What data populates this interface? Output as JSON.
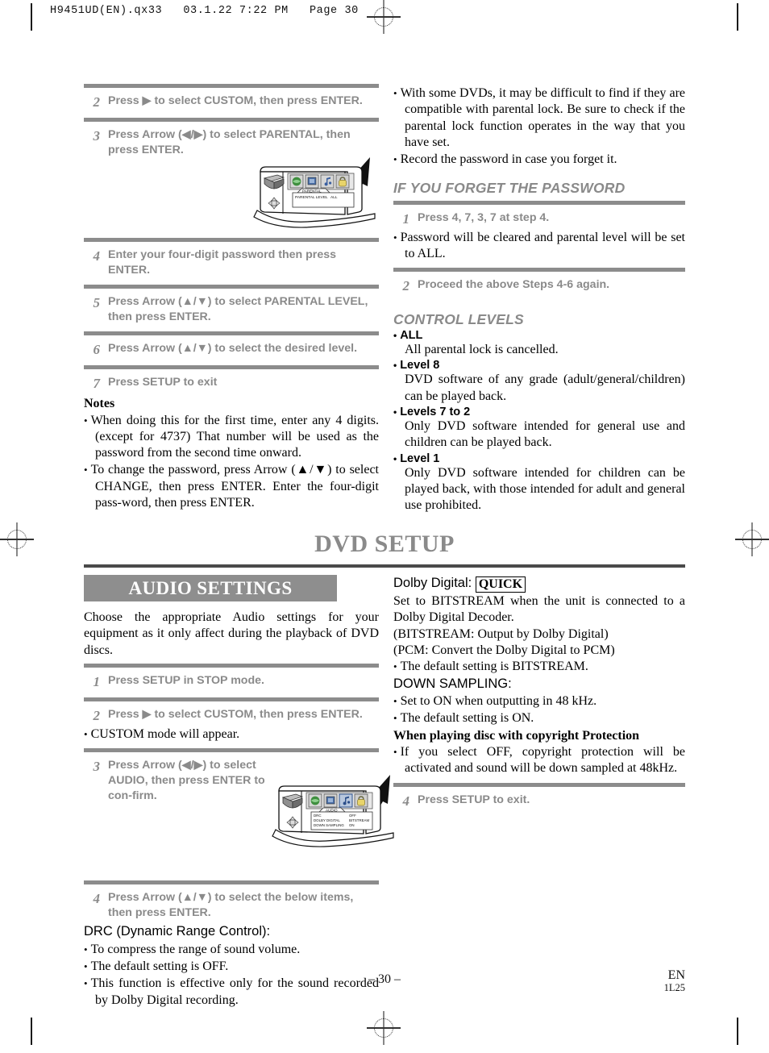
{
  "file_header": "H9451UD(EN).qx33   03.1.22 7:22 PM   Page 30",
  "left_column": {
    "parental_steps": [
      {
        "num": "2",
        "text": "Press ▶ to select CUSTOM, then press ENTER."
      },
      {
        "num": "3",
        "text": "Press Arrow (◀/▶) to select PARENTAL, then press ENTER."
      },
      {
        "num": "4",
        "text": "Enter your four-digit password then press ENTER."
      },
      {
        "num": "5",
        "text": "Press Arrow (▲/▼) to select PARENTAL LEVEL, then press ENTER."
      },
      {
        "num": "6",
        "text": "Press Arrow (▲/▼) to select the desired level."
      },
      {
        "num": "7",
        "text": "Press SETUP to exit"
      }
    ],
    "notes_title": "Notes",
    "notes": [
      "When doing this for the first time, enter any 4 digits. (except for 4737) That number will be used as the password from the second time onward.",
      "To change the password, press Arrow (▲/▼) to select CHANGE, then press ENTER. Enter the four-digit pass-word, then press ENTER."
    ],
    "tv_parental": {
      "menu_title": "PARENTAL",
      "row_label": "PARENTAL LEVEL",
      "row_value": "ALL"
    },
    "audio_intro": "Choose the appropriate Audio settings for your equipment as it only affect during the playback of DVD discs.",
    "audio_steps": [
      {
        "num": "1",
        "text": "Press SETUP in STOP mode."
      },
      {
        "num": "2",
        "text": "Press ▶ to select CUSTOM, then press ENTER."
      },
      {
        "num": "3",
        "text": "Press Arrow (◀/▶) to select AUDIO, then press ENTER to con-firm."
      },
      {
        "num": "4",
        "text": "Press Arrow (▲/▼) to select the below items, then press ENTER."
      }
    ],
    "audio_step2_note": "CUSTOM mode will appear.",
    "tv_audio": {
      "menu_title": "AUDIO",
      "rows": [
        {
          "label": "DRC",
          "value": "OFF"
        },
        {
          "label": "DOLBY DIGITAL",
          "value": "BITSTREAM"
        },
        {
          "label": "DOWN SAMPLING",
          "value": "ON"
        }
      ]
    },
    "drc_title": "DRC (Dynamic Range Control):",
    "drc_bullets": [
      "To compress the range of sound volume.",
      "The default setting is OFF.",
      "This function is effective only for the sound recorded by Dolby Digital recording."
    ]
  },
  "right_column": {
    "top_bullets": [
      "With some DVDs, it may be difficult to find if they are compatible with parental lock. Be sure to check if the parental lock function operates in the way that you have set.",
      "Record the password in case you forget it."
    ],
    "forget_heading": "IF YOU FORGET THE PASSWORD",
    "forget_steps": [
      {
        "num": "1",
        "text": "Press 4, 7, 3, 7 at step 4."
      },
      {
        "num": "2",
        "text": "Proceed the above Steps 4-6 again."
      }
    ],
    "forget_note": "Password will be cleared and parental level will be set to ALL.",
    "control_levels_heading": "CONTROL LEVELS",
    "control_levels": [
      {
        "label": "ALL",
        "desc": "All parental lock is cancelled."
      },
      {
        "label": "Level 8",
        "desc": "DVD software of any grade (adult/general/children) can be played back."
      },
      {
        "label": "Levels 7 to 2",
        "desc": "Only DVD software intended for general use and children can be played back."
      },
      {
        "label": "Level 1",
        "desc": "Only DVD software intended for children can be played back, with those intended for adult and general use prohibited."
      }
    ],
    "dolby_label": "Dolby Digital:",
    "quick_badge": "QUICK",
    "dolby_lines": [
      "Set to BITSTREAM when the unit is connected to a Dolby Digital Decoder.",
      "(BITSTREAM: Output by Dolby Digital)",
      "(PCM: Convert the Dolby Digital to PCM)"
    ],
    "dolby_default": "The default setting is BITSTREAM.",
    "down_sampling_title": "DOWN SAMPLING:",
    "down_sampling_bullets": [
      "Set to ON when outputting in 48 kHz.",
      "The default setting is ON."
    ],
    "copyright_title": "When playing disc with copyright Protection",
    "copyright_bullet": "If you select OFF, copyright protection will be activated and sound will be down sampled at 48kHz.",
    "exit_step": {
      "num": "4",
      "text": "Press SETUP to exit."
    }
  },
  "section_titles": {
    "dvd_setup": "DVD SETUP",
    "audio_settings": "AUDIO SETTINGS"
  },
  "footer": {
    "page_number": "– 30 –",
    "lang": "EN",
    "code": "1L25"
  },
  "colors": {
    "gray_rule": "#8c8c8c",
    "banner_gray": "#8e8e8e",
    "step_text_gray": "#8a8a8a",
    "dark_rule": "#4a4a4a"
  }
}
